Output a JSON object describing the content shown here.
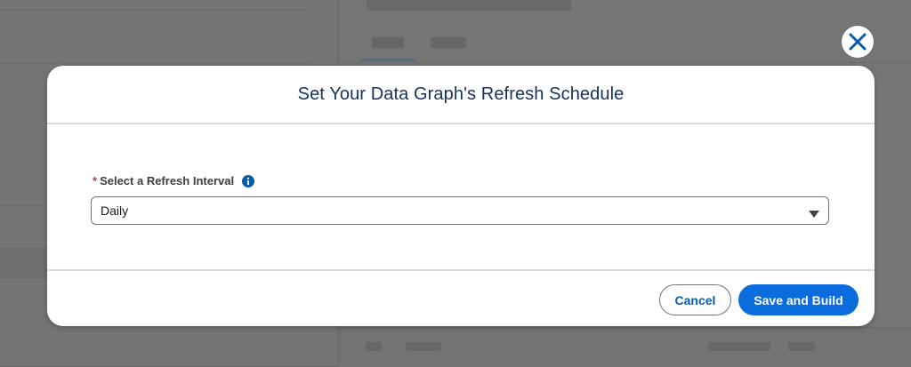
{
  "modal": {
    "title": "Set Your Data Graph's Refresh Schedule",
    "field": {
      "required_marker": "*",
      "label": "Select a Refresh Interval",
      "info_icon": "info-icon",
      "selected_value": "Daily"
    },
    "buttons": {
      "cancel_label": "Cancel",
      "save_label": "Save and Build"
    }
  },
  "close_icon": "close-icon",
  "colors": {
    "brand_blue": "#0b6cde",
    "title_navy": "#16325c",
    "required_red": "#c23934",
    "overlay": "#727272"
  }
}
